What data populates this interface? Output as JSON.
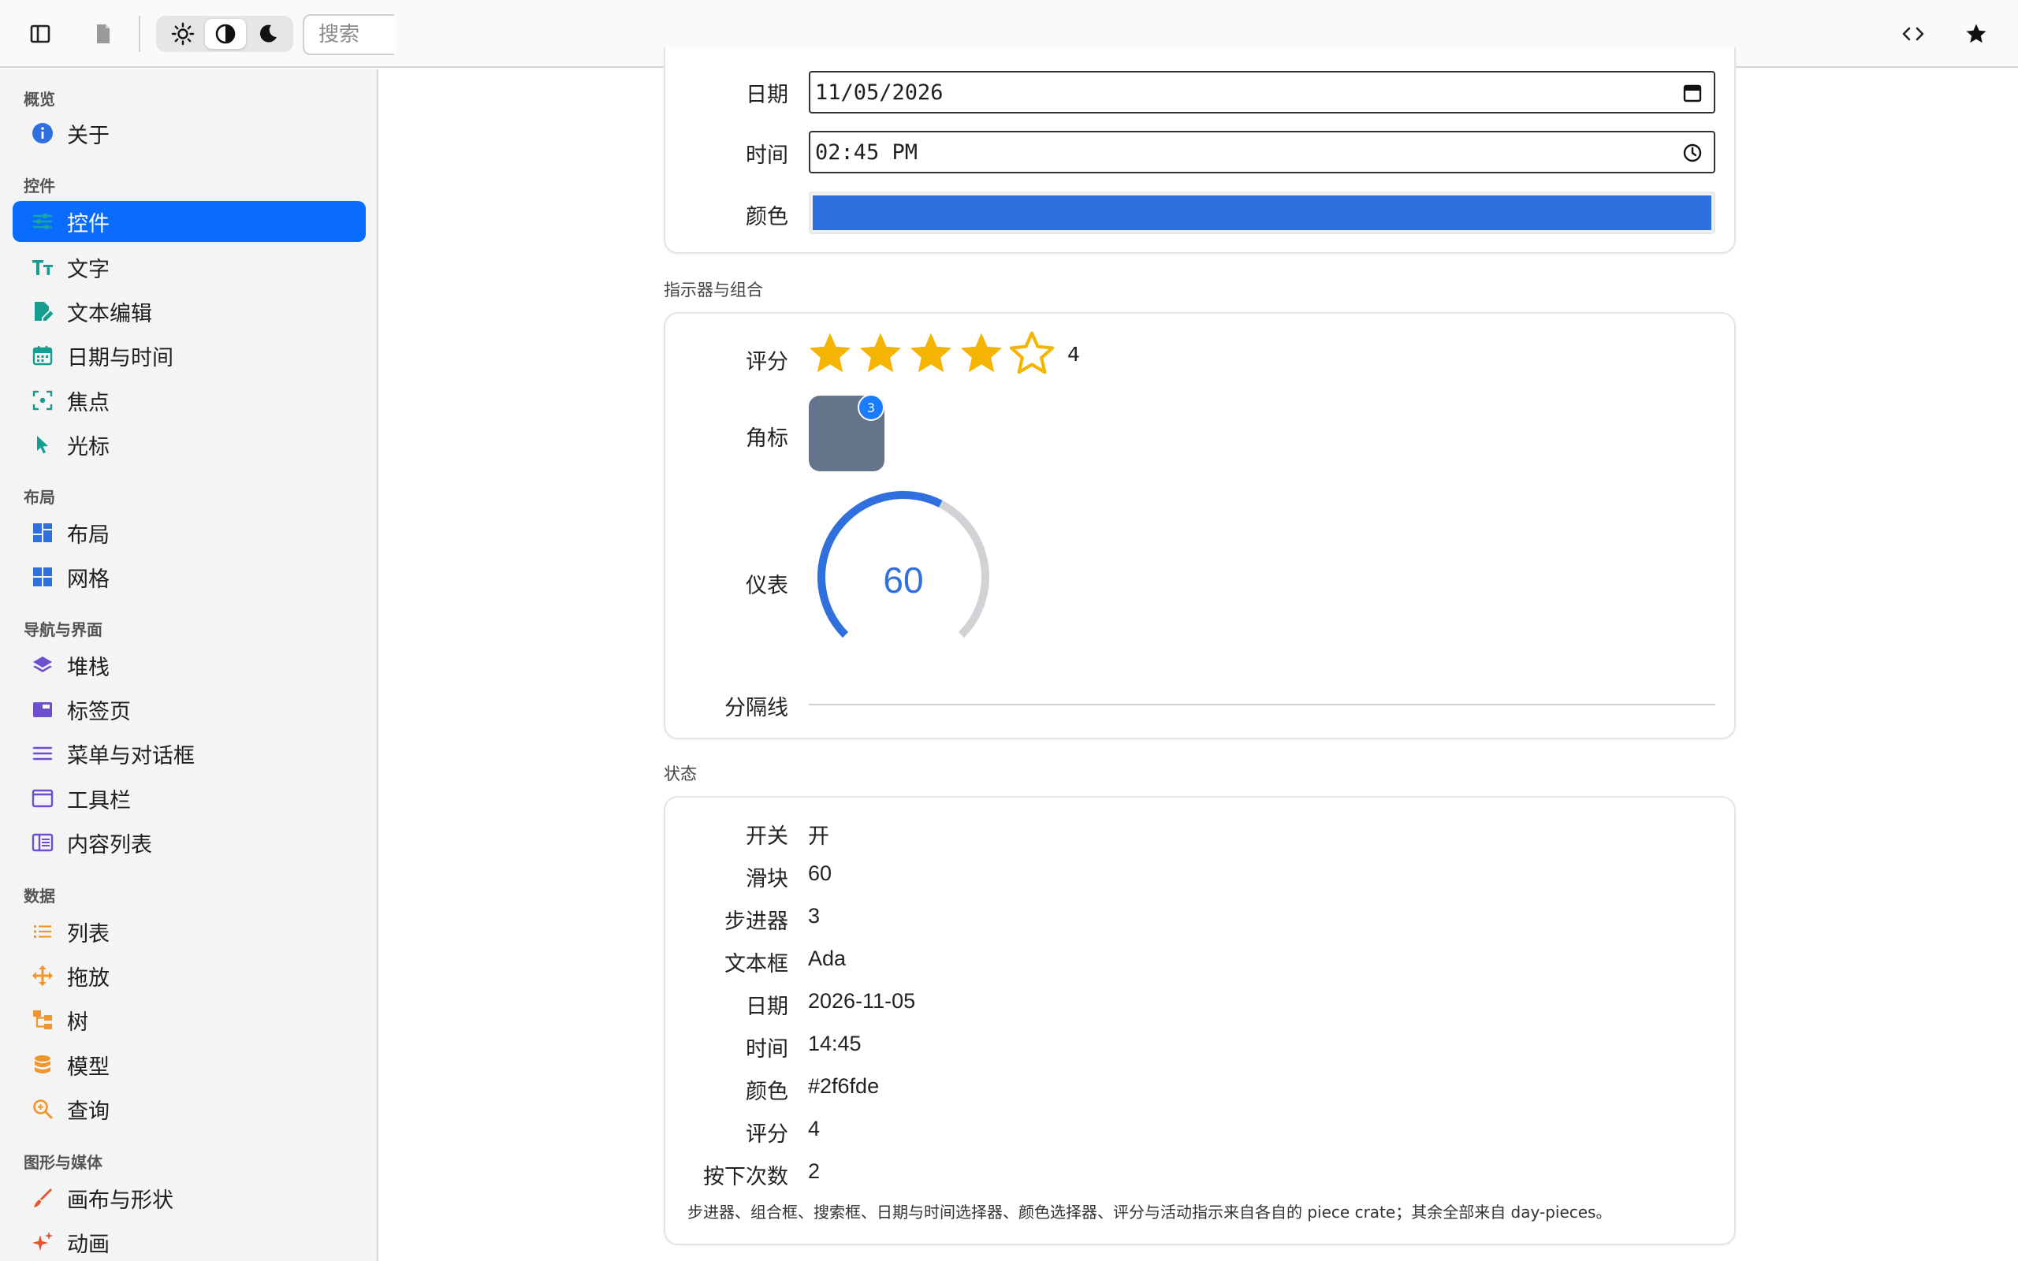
{
  "toolbar": {
    "search_placeholder": "搜索"
  },
  "sidebar": {
    "sections": [
      {
        "title": "概览",
        "items": [
          {
            "label": "关于",
            "icon": "info-icon"
          }
        ]
      },
      {
        "title": "控件",
        "items": [
          {
            "label": "控件",
            "icon": "sliders-icon",
            "active": true
          },
          {
            "label": "文字",
            "icon": "text-icon"
          },
          {
            "label": "文本编辑",
            "icon": "edit-icon"
          },
          {
            "label": "日期与时间",
            "icon": "calendar-icon"
          },
          {
            "label": "焦点",
            "icon": "focus-icon"
          },
          {
            "label": "光标",
            "icon": "cursor-icon"
          }
        ]
      },
      {
        "title": "布局",
        "items": [
          {
            "label": "布局",
            "icon": "layout-icon"
          },
          {
            "label": "网格",
            "icon": "grid-icon"
          }
        ]
      },
      {
        "title": "导航与界面",
        "items": [
          {
            "label": "堆栈",
            "icon": "layers-icon"
          },
          {
            "label": "标签页",
            "icon": "tabs-icon"
          },
          {
            "label": "菜单与对话框",
            "icon": "menu-icon"
          },
          {
            "label": "工具栏",
            "icon": "window-icon"
          },
          {
            "label": "内容列表",
            "icon": "columns-icon"
          }
        ]
      },
      {
        "title": "数据",
        "items": [
          {
            "label": "列表",
            "icon": "list-icon"
          },
          {
            "label": "拖放",
            "icon": "move-icon"
          },
          {
            "label": "树",
            "icon": "tree-icon"
          },
          {
            "label": "模型",
            "icon": "database-icon"
          },
          {
            "label": "查询",
            "icon": "search-icon"
          }
        ]
      },
      {
        "title": "图形与媒体",
        "items": [
          {
            "label": "画布与形状",
            "icon": "brush-icon"
          },
          {
            "label": "动画",
            "icon": "sparkle-icon"
          }
        ]
      }
    ]
  },
  "inputs": {
    "date_label": "日期",
    "date_value": "11/05/2026",
    "time_label": "时间",
    "time_value": "02:45 PM",
    "color_label": "颜色",
    "color_value": "#2f6fde"
  },
  "indicators": {
    "title": "指示器与组合",
    "rating_label": "评分",
    "rating_value": "4",
    "rating_max": 5,
    "badge_label": "角标",
    "badge_count": "3",
    "gauge_label": "仪表",
    "gauge_value": "60",
    "gauge_fraction": 0.6,
    "divider_label": "分隔线"
  },
  "state": {
    "title": "状态",
    "rows": [
      {
        "label": "开关",
        "value": "开"
      },
      {
        "label": "滑块",
        "value": "60"
      },
      {
        "label": "步进器",
        "value": "3"
      },
      {
        "label": "文本框",
        "value": "Ada"
      },
      {
        "label": "日期",
        "value": "2026-11-05"
      },
      {
        "label": "时间",
        "value": "14:45"
      },
      {
        "label": "颜色",
        "value": "#2f6fde"
      },
      {
        "label": "评分",
        "value": "4"
      },
      {
        "label": "按下次数",
        "value": "2"
      }
    ],
    "footnote": "步进器、组合框、搜索框、日期与时间选择器、颜色选择器、评分与活动指示来自各自的 piece crate；其余全部来自 day-pieces。"
  },
  "colors": {
    "accent": "#0a6cff",
    "gauge": "#2f6fde",
    "star": "#f4b400",
    "badge_box": "#64748b"
  }
}
